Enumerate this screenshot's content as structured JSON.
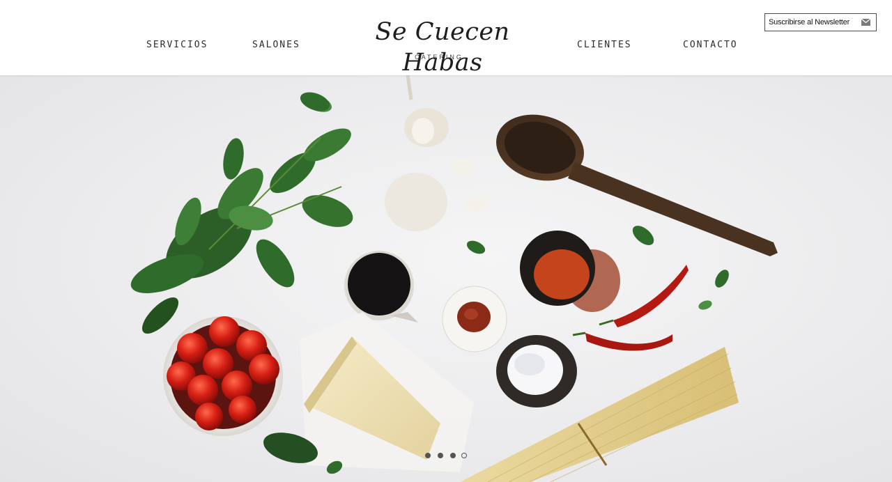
{
  "nav": {
    "left": [
      {
        "label": "SERVICIOS"
      },
      {
        "label": "SALONES"
      }
    ],
    "right": [
      {
        "label": "CLIENTES"
      },
      {
        "label": "CONTACTO"
      }
    ]
  },
  "logo": {
    "script": "Se Cuecen Habas",
    "subtitle": "CATERING"
  },
  "newsletter": {
    "label": "Suscribirse al Newsletter",
    "icon": "envelope-icon"
  },
  "carousel": {
    "slide_count": 4,
    "active_index": 3
  },
  "colors": {
    "text": "#2b2b2b",
    "background": "#ffffff"
  }
}
